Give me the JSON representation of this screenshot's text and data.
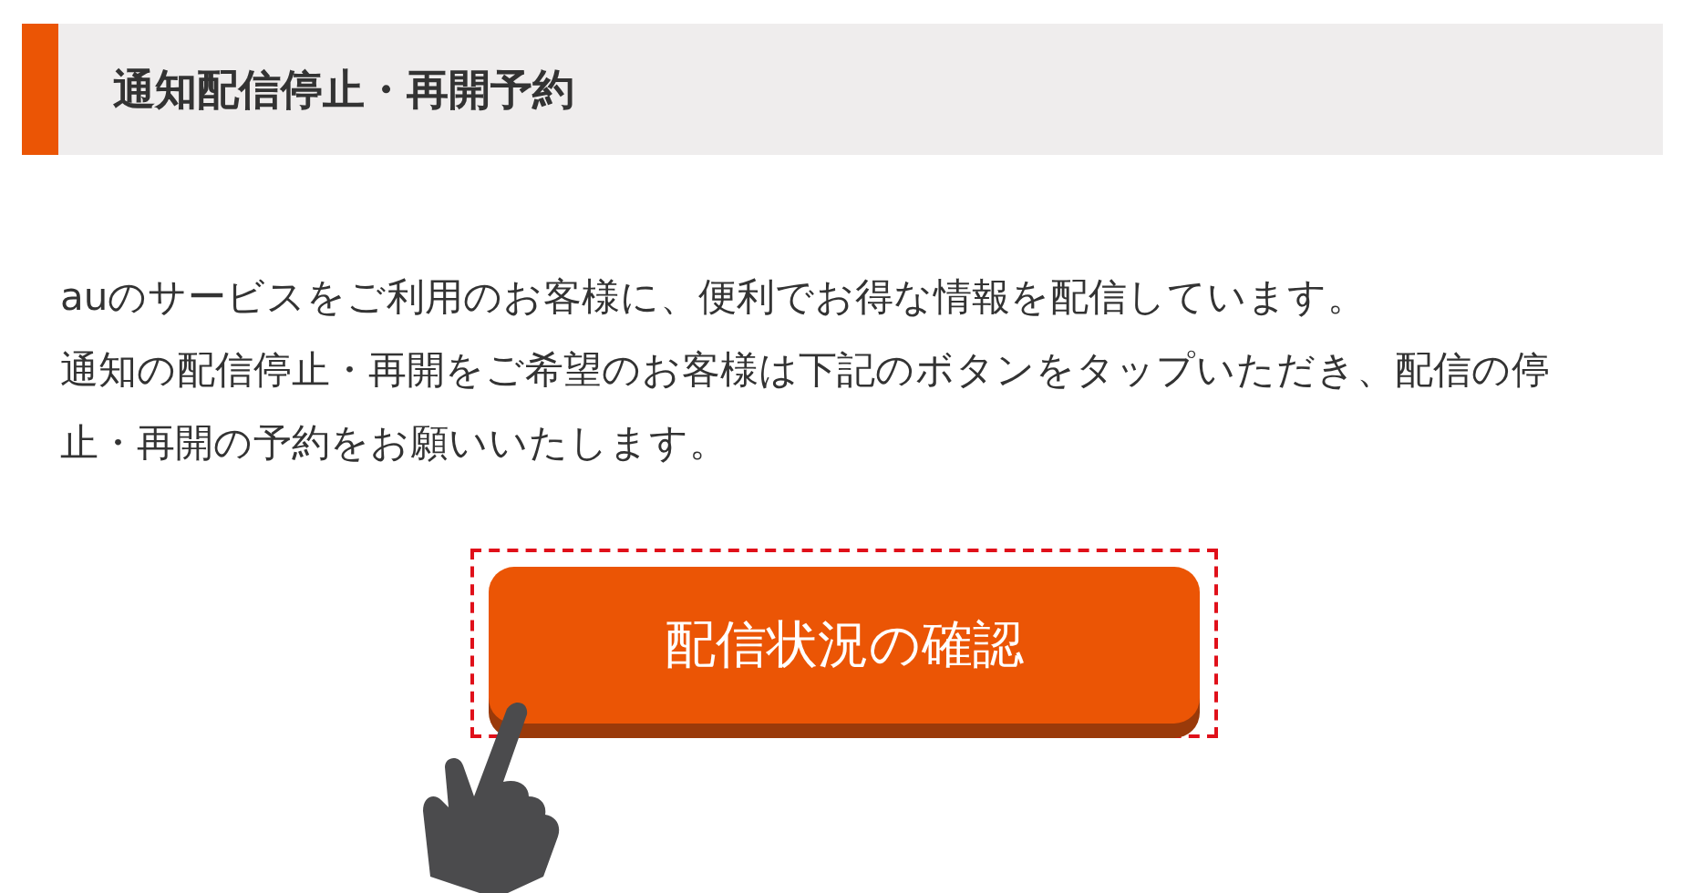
{
  "heading": {
    "title": "通知配信停止・再開予約"
  },
  "paragraphs": [
    "auのサービスをご利用のお客様に、便利でお得な情報を配信しています。",
    "通知の配信停止・再開をご希望のお客様は下記のボタンをタップいただき、配信の停止・再開の予約をお願いいたします。"
  ],
  "button": {
    "label": "配信状況の確認"
  }
}
